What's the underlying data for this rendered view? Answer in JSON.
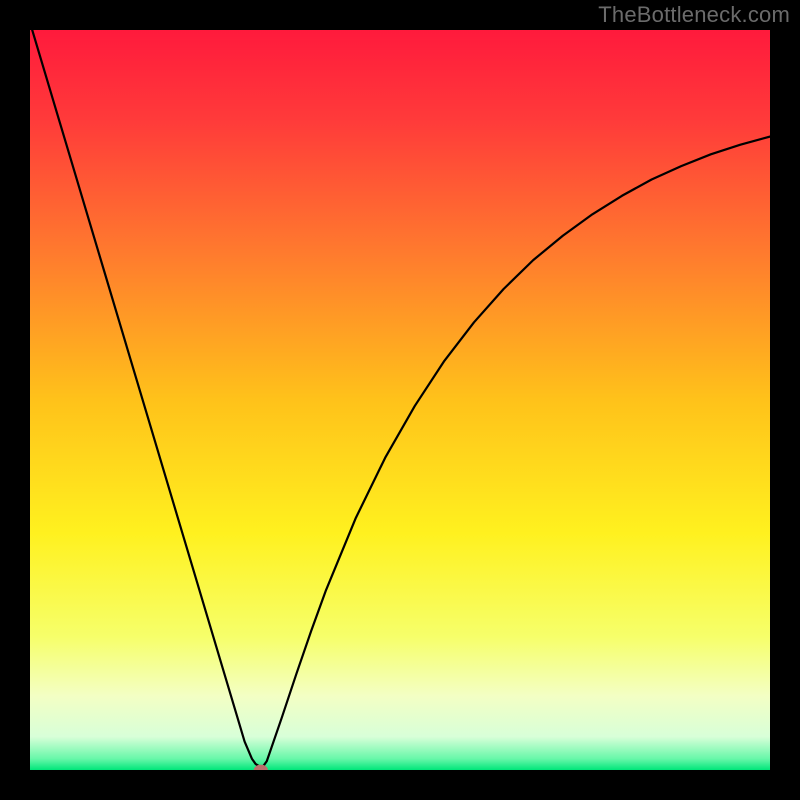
{
  "watermark": "TheBottleneck.com",
  "chart_data": {
    "type": "line",
    "title": "",
    "xlabel": "",
    "ylabel": "",
    "xlim": [
      0,
      100
    ],
    "ylim": [
      0,
      100
    ],
    "grid": false,
    "legend": false,
    "background_gradient_stops": [
      {
        "offset": 0.0,
        "color": "#ff1a3c"
      },
      {
        "offset": 0.12,
        "color": "#ff3a3a"
      },
      {
        "offset": 0.3,
        "color": "#ff7a2e"
      },
      {
        "offset": 0.5,
        "color": "#ffc21a"
      },
      {
        "offset": 0.68,
        "color": "#fff11f"
      },
      {
        "offset": 0.82,
        "color": "#f6ff6a"
      },
      {
        "offset": 0.9,
        "color": "#f3ffc4"
      },
      {
        "offset": 0.955,
        "color": "#d8ffd8"
      },
      {
        "offset": 0.985,
        "color": "#67f7a9"
      },
      {
        "offset": 1.0,
        "color": "#00e67a"
      }
    ],
    "series": [
      {
        "name": "bottleneck-curve",
        "x": [
          0,
          2,
          4,
          6,
          8,
          10,
          12,
          14,
          16,
          18,
          20,
          22,
          24,
          26,
          28,
          29,
          30,
          30.5,
          31,
          31.5,
          32,
          34,
          36,
          38,
          40,
          44,
          48,
          52,
          56,
          60,
          64,
          68,
          72,
          76,
          80,
          84,
          88,
          92,
          96,
          100
        ],
        "y": [
          101,
          94.3,
          87.6,
          80.9,
          74.2,
          67.5,
          60.8,
          54.1,
          47.4,
          40.7,
          34.0,
          27.3,
          20.6,
          13.9,
          7.2,
          3.85,
          1.5,
          0.8,
          0.5,
          0.5,
          1.2,
          7.0,
          13.0,
          18.8,
          24.3,
          34.0,
          42.2,
          49.2,
          55.3,
          60.5,
          65.0,
          68.9,
          72.2,
          75.1,
          77.6,
          79.8,
          81.6,
          83.2,
          84.5,
          85.6
        ]
      }
    ],
    "marker": {
      "x": 31.2,
      "y": 0.0,
      "rx": 0.95,
      "ry": 0.72,
      "color": "#b9706c"
    }
  }
}
